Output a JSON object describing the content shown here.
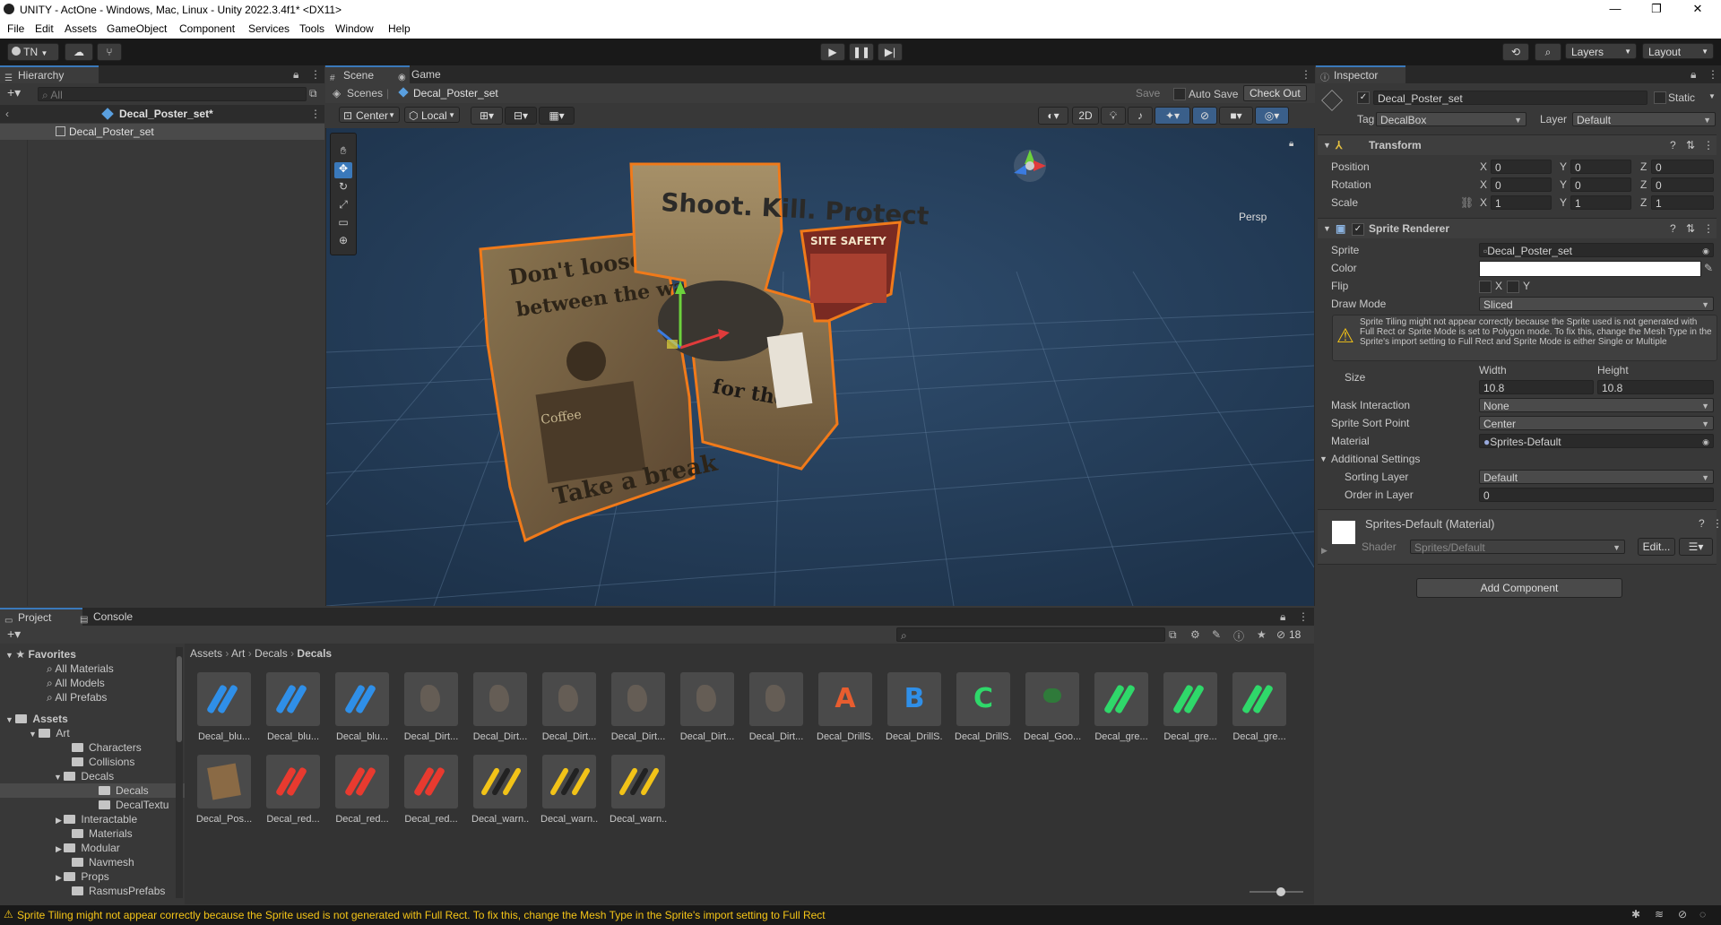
{
  "window": {
    "title": "UNITY - ActOne - Windows, Mac, Linux - Unity 2022.3.4f1* <DX11>",
    "controls": [
      "—",
      "❐",
      "✕"
    ]
  },
  "menu": [
    "File",
    "Edit",
    "Assets",
    "GameObject",
    "Component",
    "Services",
    "Tools",
    "Window",
    "Help"
  ],
  "toolbar": {
    "account": "TN",
    "layers": "Layers",
    "layout": "Layout"
  },
  "hierarchy": {
    "tab": "Hierarchy",
    "search_placeholder": "All",
    "scene_name": "Decal_Poster_set*",
    "items": [
      "Decal_Poster_set"
    ]
  },
  "scene": {
    "tabs": [
      "Scene",
      "Game"
    ],
    "breadcrumb_root": "Scenes",
    "breadcrumb_item": "Decal_Poster_set",
    "save": "Save",
    "auto_save": "Auto Save",
    "check_out": "Check Out",
    "pivot": "Center",
    "space": "Local",
    "mode_2d": "2D",
    "persp": "Persp",
    "poster_left_top": "Don't loose yourself",
    "poster_left_mid": "between the waves!",
    "poster_left_cup": "Coffee",
    "poster_left_bottom": "Take a break",
    "poster_center_title": "Shoot. Kill. Protect",
    "poster_center_bottom": "for the",
    "poster_right_title": "SITE SAFETY"
  },
  "inspector": {
    "tab": "Inspector",
    "object_name": "Decal_Poster_set",
    "static_label": "Static",
    "tag_label": "Tag",
    "tag_value": "DecalBox",
    "layer_label": "Layer",
    "layer_value": "Default",
    "transform": {
      "title": "Transform",
      "position_label": "Position",
      "rotation_label": "Rotation",
      "scale_label": "Scale",
      "position": [
        "0",
        "0",
        "0"
      ],
      "rotation": [
        "0",
        "0",
        "0"
      ],
      "scale": [
        "1",
        "1",
        "1"
      ],
      "axes": [
        "X",
        "Y",
        "Z"
      ]
    },
    "sprite_renderer": {
      "title": "Sprite Renderer",
      "sprite_label": "Sprite",
      "sprite_value": "Decal_Poster_set",
      "color_label": "Color",
      "color_value": "#ffffff",
      "flip_label": "Flip",
      "flip_x": "X",
      "flip_y": "Y",
      "draw_mode_label": "Draw Mode",
      "draw_mode_value": "Sliced",
      "warning": "Sprite Tiling might not appear correctly because the Sprite used is not generated with Full Rect or Sprite Mode is set to Polygon mode. To fix this, change the Mesh Type in the Sprite's import setting to Full Rect and Sprite Mode is either Single or Multiple",
      "size_label": "Size",
      "width_label": "Width",
      "height_label": "Height",
      "width_value": "10.8",
      "height_value": "10.8",
      "mask_label": "Mask Interaction",
      "mask_value": "None",
      "sort_point_label": "Sprite Sort Point",
      "sort_point_value": "Center",
      "material_label": "Material",
      "material_value": "Sprites-Default",
      "additional_label": "Additional Settings",
      "sorting_layer_label": "Sorting Layer",
      "sorting_layer_value": "Default",
      "order_label": "Order in Layer",
      "order_value": "0"
    },
    "material": {
      "title": "Sprites-Default (Material)",
      "shader_label": "Shader",
      "shader_value": "Sprites/Default",
      "edit": "Edit..."
    },
    "add_component": "Add Component"
  },
  "project": {
    "tabs": [
      "Project",
      "Console"
    ],
    "hidden_count": "18",
    "breadcrumb": [
      "Assets",
      "Art",
      "Decals",
      "Decals"
    ],
    "favorites": "Favorites",
    "favorite_items": [
      "All Materials",
      "All Models",
      "All Prefabs"
    ],
    "tree": {
      "assets": "Assets",
      "art": "Art",
      "art_children": [
        "Characters",
        "Collisions"
      ],
      "decals": "Decals",
      "decals_children": [
        "Decals",
        "DecalTextu"
      ],
      "art_rest": [
        "Interactable",
        "Materials",
        "Modular",
        "Navmesh",
        "Props",
        "RasmusPrefabs"
      ]
    },
    "assets_row1": [
      "Decal_blu...",
      "Decal_blu...",
      "Decal_blu...",
      "Decal_Dirt...",
      "Decal_Dirt...",
      "Decal_Dirt...",
      "Decal_Dirt...",
      "Decal_Dirt...",
      "Decal_Dirt...",
      "Decal_DrillS...",
      "Decal_DrillS...",
      "Decal_DrillS...",
      "Decal_Goo...",
      "Decal_gre...",
      "Decal_gre...",
      "Decal_gre..."
    ],
    "assets_row2": [
      "Decal_Pos...",
      "Decal_red...",
      "Decal_red...",
      "Decal_red...",
      "Decal_warn...",
      "Decal_warn...",
      "Decal_warn..."
    ],
    "drill_letters": [
      "A",
      "B",
      "C"
    ]
  },
  "statusbar": {
    "message": "Sprite Tiling might not appear correctly because the Sprite used is not generated with Full Rect. To fix this, change the Mesh Type in the Sprite's import setting to Full Rect"
  },
  "colors": {
    "accent": "#3a79bb",
    "selection_outline": "#f07a1a",
    "warning": "#f5c517",
    "scene_bg": "#223851"
  }
}
